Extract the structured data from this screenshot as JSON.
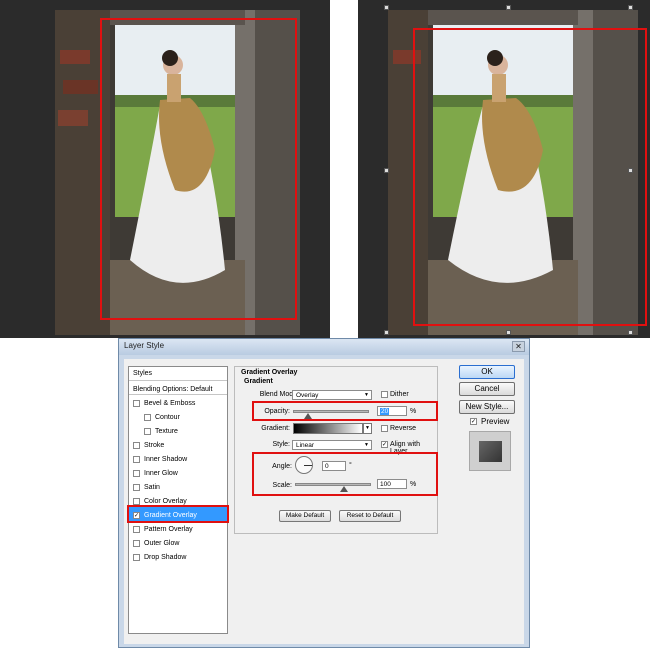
{
  "dialog": {
    "title": "Layer Style",
    "close_icon": "close-icon"
  },
  "side_list": {
    "header": "Styles",
    "items": [
      {
        "label": "Blending Options: Default",
        "checkbox": false,
        "checked": false,
        "indent": false
      },
      {
        "label": "Bevel & Emboss",
        "checkbox": true,
        "checked": false,
        "indent": false
      },
      {
        "label": "Contour",
        "checkbox": true,
        "checked": false,
        "indent": true
      },
      {
        "label": "Texture",
        "checkbox": true,
        "checked": false,
        "indent": true
      },
      {
        "label": "Stroke",
        "checkbox": true,
        "checked": false,
        "indent": false
      },
      {
        "label": "Inner Shadow",
        "checkbox": true,
        "checked": false,
        "indent": false
      },
      {
        "label": "Inner Glow",
        "checkbox": true,
        "checked": false,
        "indent": false
      },
      {
        "label": "Satin",
        "checkbox": true,
        "checked": false,
        "indent": false
      },
      {
        "label": "Color Overlay",
        "checkbox": true,
        "checked": false,
        "indent": false
      },
      {
        "label": "Gradient Overlay",
        "checkbox": true,
        "checked": true,
        "indent": false,
        "active": true
      },
      {
        "label": "Pattern Overlay",
        "checkbox": true,
        "checked": false,
        "indent": false
      },
      {
        "label": "Outer Glow",
        "checkbox": true,
        "checked": false,
        "indent": false
      },
      {
        "label": "Drop Shadow",
        "checkbox": true,
        "checked": false,
        "indent": false
      }
    ]
  },
  "gradient_overlay": {
    "title": "Gradient Overlay",
    "subtitle": "Gradient",
    "blend_mode_label": "Blend Mode:",
    "blend_mode_value": "Overlay",
    "dither_label": "Dither",
    "opacity_label": "Opacity:",
    "opacity_value": "20",
    "opacity_unit": "%",
    "gradient_label": "Gradient:",
    "reverse_label": "Reverse",
    "style_label": "Style:",
    "style_value": "Linear",
    "align_label": "Align with Layer",
    "angle_label": "Angle:",
    "angle_value": "0",
    "angle_unit": "°",
    "scale_label": "Scale:",
    "scale_value": "100",
    "scale_unit": "%",
    "make_default": "Make Default",
    "reset_default": "Reset to Default"
  },
  "buttons": {
    "ok": "OK",
    "cancel": "Cancel",
    "new_style": "New Style...",
    "preview": "Preview"
  },
  "colors": {
    "highlight": "#e01010",
    "selected": "#3399ff",
    "canvas_bg": "#2b2b2b"
  }
}
